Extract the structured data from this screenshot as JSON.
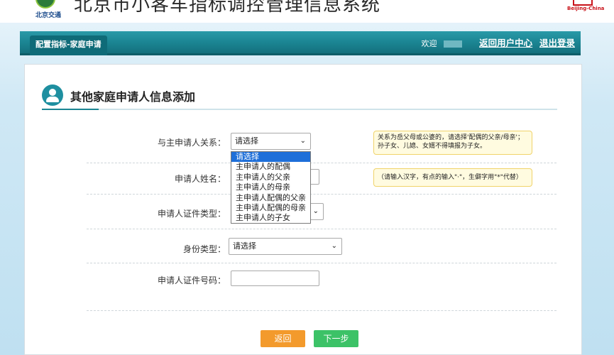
{
  "header": {
    "system_title": "北京市小客车指标调控管理信息系统",
    "logo_text": "北京交通",
    "right_logo_text": "Beijing-China"
  },
  "nav": {
    "tab_label": "配置指标-家庭申请",
    "welcome": "欢迎",
    "user_center_link": "返回用户中心",
    "logout_link": "退出登录"
  },
  "section": {
    "title": "其他家庭申请人信息添加"
  },
  "form": {
    "relation": {
      "label": "与主申请人关系：",
      "selected": "请选择",
      "hint": "关系为岳父母或公婆的，请选择'配偶的父亲/母亲'；孙子女、儿媳、女婿不得填报为子女。",
      "options": [
        "请选择",
        "主申请人的配偶",
        "主申请人的父亲",
        "主申请人的母亲",
        "主申请人配偶的父亲",
        "主申请人配偶的母亲",
        "主申请人的子女"
      ]
    },
    "name": {
      "label": "申请人姓名：",
      "value": "",
      "hint": "（请输入汉字，有点的输入\"·\"，生僻字用\"*\"代替）"
    },
    "id_type": {
      "label": "申请人证件类型："
    },
    "identity_type": {
      "label": "身份类型：",
      "selected": "请选择"
    },
    "id_number": {
      "label": "申请人证件号码：",
      "value": ""
    }
  },
  "buttons": {
    "back": "返回",
    "next": "下一步"
  },
  "colors": {
    "nav_teal": "#1b8593",
    "back_orange": "#f39a2c",
    "next_green": "#3cc267",
    "selected_blue": "#1e6fd9"
  }
}
